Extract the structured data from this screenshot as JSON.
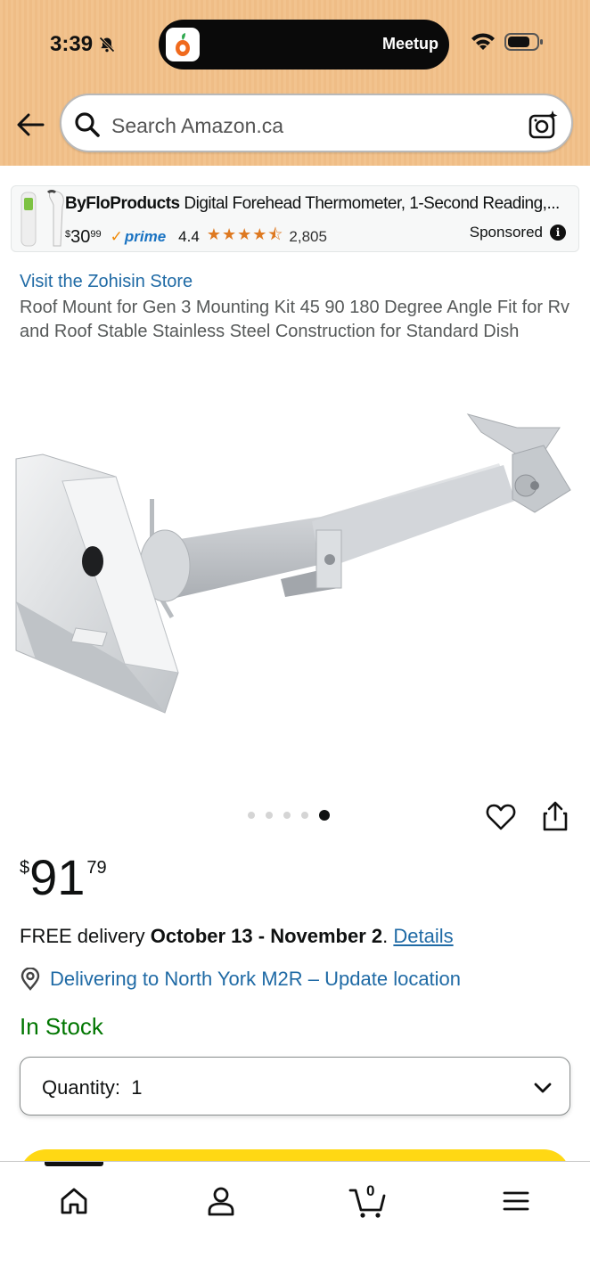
{
  "status_bar": {
    "time": "3:39",
    "activity_label": "Meetup",
    "icons": [
      "bell-slash-icon",
      "wifi-icon",
      "battery-icon"
    ]
  },
  "search": {
    "placeholder": "Search Amazon.ca",
    "icons": [
      "back-arrow-icon",
      "search-icon",
      "camera-icon"
    ]
  },
  "sponsored_ad": {
    "brand": "ByFloProducts",
    "title": " Digital Forehead Thermometer, 1-Second Reading,...",
    "price_currency": "$",
    "price_whole": "30",
    "price_fraction": "99",
    "prime_label": "prime",
    "rating": "4.4",
    "stars_glyphs": "★★★★⯪",
    "review_count": "2,805",
    "sponsored_label": "Sponsored",
    "info_glyph": "i"
  },
  "product": {
    "store_link": "Visit the Zohisin Store",
    "title": "Roof Mount for Gen 3 Mounting Kit 45 90 180 Degree Angle Fit for Rv and Roof Stable Stainless Steel Construction for Standard Dish",
    "image_count": 5,
    "active_image_index": 5,
    "price_currency": "$",
    "price_whole": "91",
    "price_fraction": "79",
    "delivery_prefix": "FREE delivery ",
    "delivery_dates": "October 13 - November 2",
    "delivery_period": ". ",
    "details_link": "Details",
    "location_text": "Delivering to North York M2R – Update location",
    "stock_status": "In Stock",
    "quantity_label": "Quantity:",
    "quantity_value": "1"
  },
  "bottom_nav": {
    "items": [
      "home-icon",
      "account-icon",
      "cart-icon",
      "menu-icon"
    ],
    "cart_count": "0",
    "active": "home"
  },
  "colors": {
    "header_bg": "#f2c38e",
    "link": "#1f6aa5",
    "in_stock": "#007600",
    "buy_button": "#ffd814",
    "stars": "#de7921",
    "prime": "#1a73c2"
  }
}
